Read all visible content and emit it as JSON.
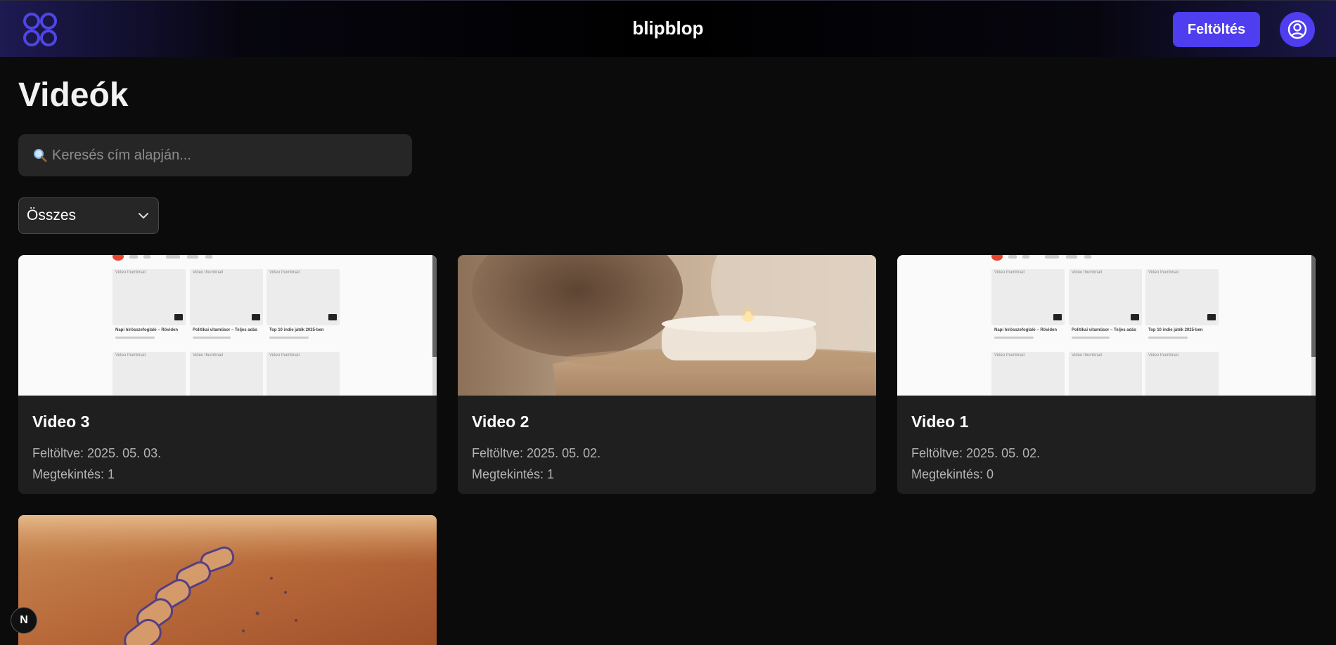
{
  "header": {
    "brand": "blipblop",
    "upload_label": "Feltöltés",
    "logo_icon": "clover-logo-icon",
    "profile_icon": "user-circle-icon",
    "accent": "#4f3df0"
  },
  "page": {
    "title": "Videók"
  },
  "search": {
    "placeholder": "Keresés cím alapján...",
    "value": "",
    "icon": "magnifier-icon"
  },
  "filter": {
    "selected": "Összes",
    "icon": "chevron-down-icon"
  },
  "videos": [
    {
      "title": "Video 3",
      "uploaded": "Feltöltve: 2025. 05. 03.",
      "views": "Megtekintés: 1",
      "thumbnail": "screenshot"
    },
    {
      "title": "Video 2",
      "uploaded": "Feltöltve: 2025. 05. 02.",
      "views": "Megtekintés: 1",
      "thumbnail": "candle"
    },
    {
      "title": "Video 1",
      "uploaded": "Feltöltve: 2025. 05. 02.",
      "views": "Megtekintés: 0",
      "thumbnail": "screenshot"
    }
  ],
  "thumb_text": {
    "tile_label": "Video thumbnail",
    "cap1": "Napi hírösszefoglaló – Röviden",
    "cap2": "Politikai vitaműsor – Teljes adás",
    "cap3": "Top 10 indie játék 2025-ben"
  },
  "dev_badge": "N"
}
